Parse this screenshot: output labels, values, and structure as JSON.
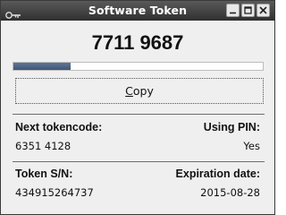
{
  "window": {
    "title": "Software Token"
  },
  "token": {
    "code": "7711 9687",
    "progress": 0.23
  },
  "buttons": {
    "copy_mnemonic": "C",
    "copy_rest": "opy"
  },
  "fields": {
    "next_tokencode_label": "Next tokencode:",
    "next_tokencode_value": "6351 4128",
    "using_pin_label": "Using PIN:",
    "using_pin_value": "Yes",
    "serial_label": "Token S/N:",
    "serial_value": "434915264737",
    "expiration_label": "Expiration date:",
    "expiration_value": "2015-08-28"
  },
  "icons": {
    "sysmenu": "key-icon",
    "minimize": "minimize-icon",
    "maximize": "maximize-icon",
    "close": "close-icon"
  },
  "colors": {
    "titlebar": "#3d3d3d",
    "progress_fill": "#4d6483",
    "window_bg": "#efefef"
  }
}
